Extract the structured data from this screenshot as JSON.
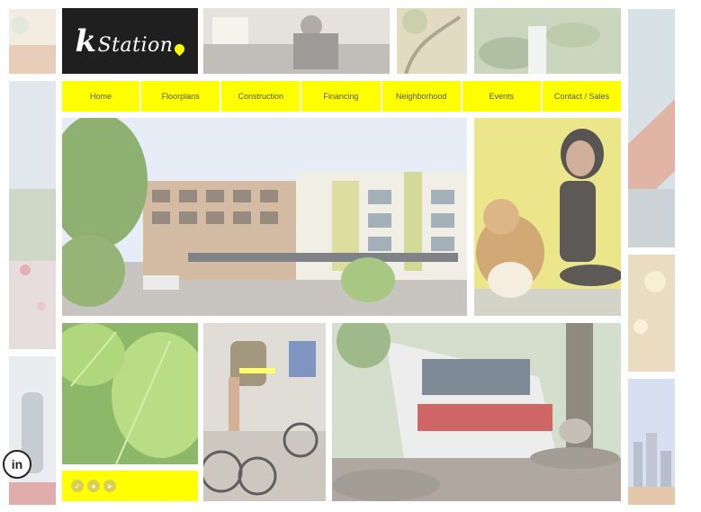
{
  "logo": {
    "k": "k",
    "rest": "Station"
  },
  "nav": {
    "items": [
      "Home",
      "Floorplans",
      "Construction",
      "Financing",
      "Neighborhood",
      "Events",
      "Contact / Sales"
    ]
  },
  "social": {
    "linkedin_label": "in"
  },
  "colors": {
    "accent": "#ffff00",
    "logo_bg": "#1f1f1f"
  }
}
